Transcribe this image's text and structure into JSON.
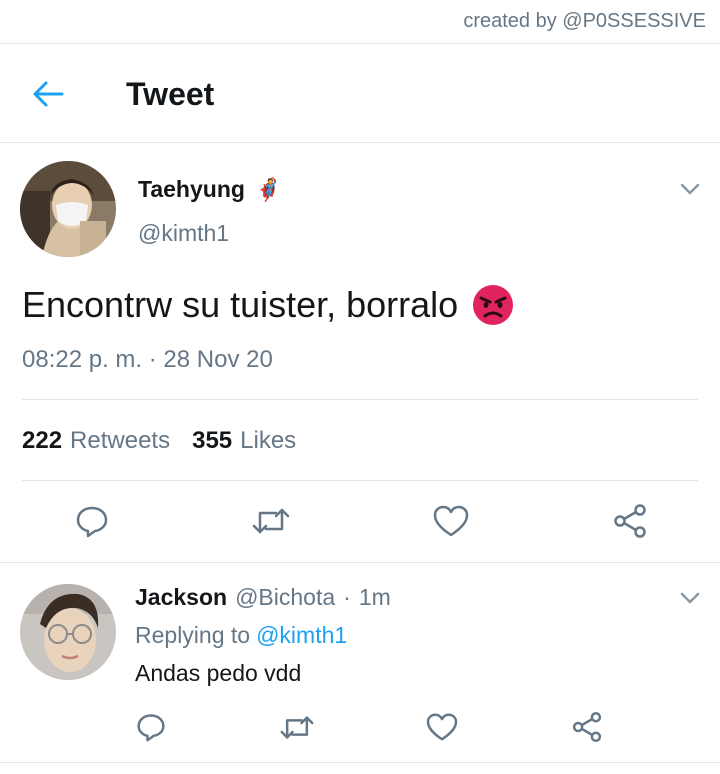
{
  "credit": "created by @P0SSESSIVE",
  "header": {
    "title": "Tweet"
  },
  "tweet": {
    "author_name": "Taehyung",
    "author_emoji": "🦸",
    "author_handle": "@kimth1",
    "text": "Encontrw su tuister, borralo",
    "timestamp": "08:22 p. m. · 28 Nov 20",
    "retweets_count": "222",
    "retweets_label": "Retweets",
    "likes_count": "355",
    "likes_label": "Likes"
  },
  "reply": {
    "author_name": "Jackson",
    "author_handle": "@Bichota",
    "separator": "·",
    "time": "1m",
    "replying_label": "Replying to",
    "replying_handle": "@kimth1",
    "text": "Andas pedo vdd"
  },
  "icons": {
    "back": "arrow-left-icon",
    "chevron": "chevron-down-icon",
    "reply": "reply-icon",
    "retweet": "retweet-icon",
    "like": "heart-icon",
    "share": "share-icon",
    "angry": "angry-face-icon"
  },
  "colors": {
    "accent": "#1da1f2",
    "secondary_text": "#657786",
    "divider": "#e1e8ed",
    "angry_face": "#e0245e"
  }
}
